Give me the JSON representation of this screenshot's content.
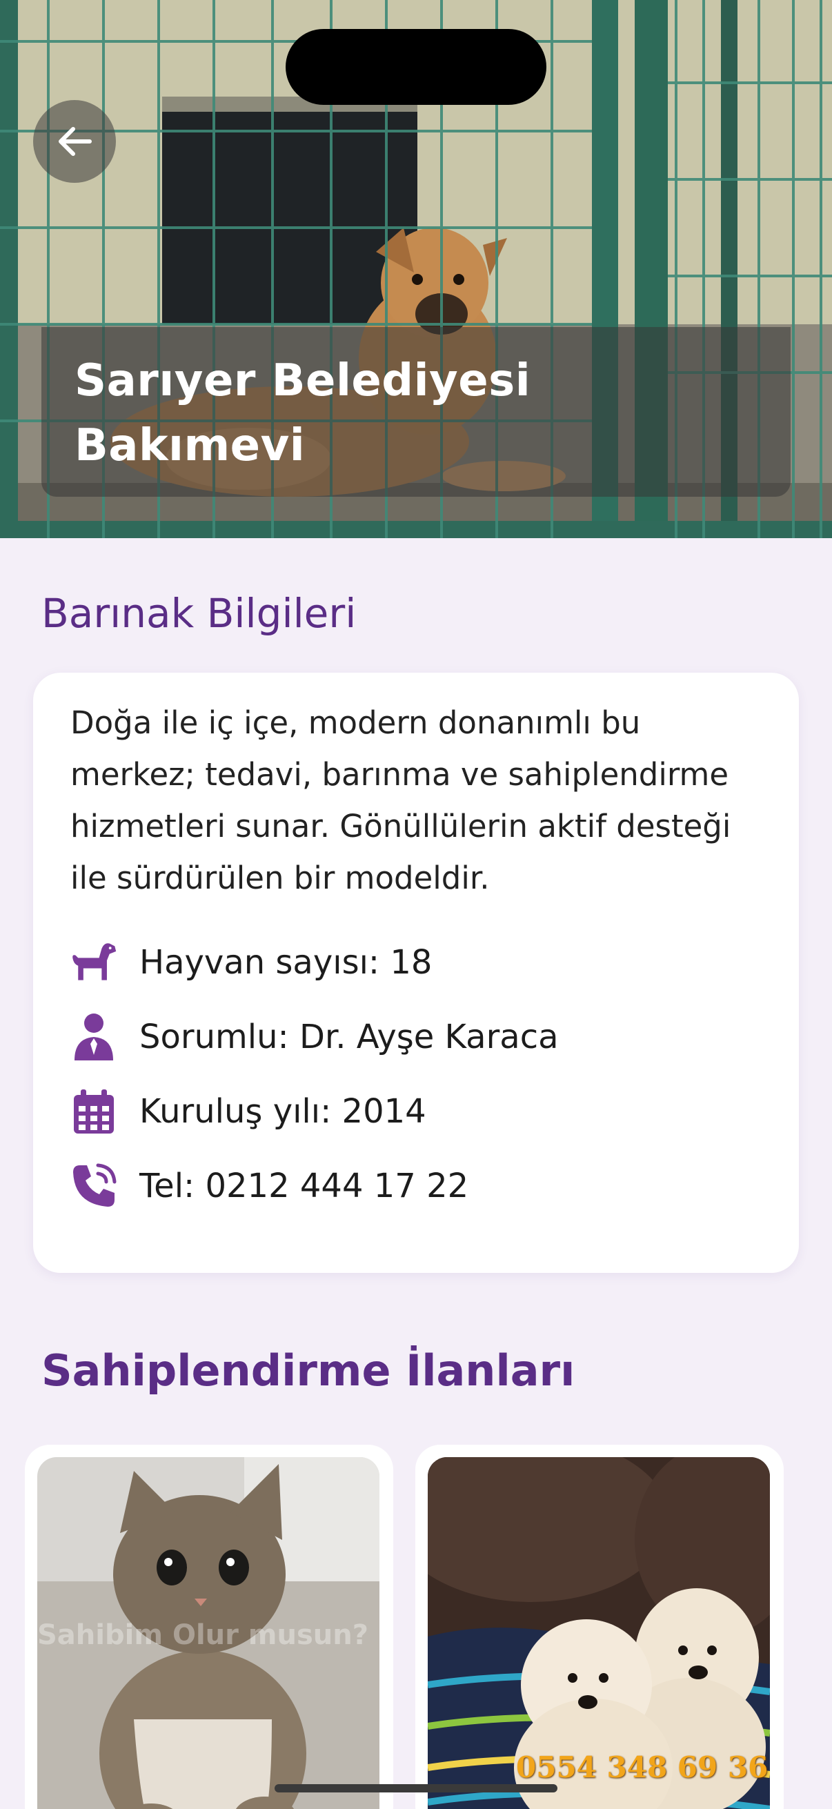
{
  "hero": {
    "title": "Sarıyer Belediyesi Bakımevi",
    "back_icon": "arrow-left-icon"
  },
  "info": {
    "section_title": "Barınak Bilgileri",
    "description": "Doğa ile iç içe, modern donanımlı bu merkez; tedavi, barınma ve sahiplendirme hizmetleri sunar. Gönüllülerin aktif desteği ile sürdürülen bir modeldir.",
    "rows": [
      {
        "icon": "dog-icon",
        "text": "Hayvan sayısı: 18"
      },
      {
        "icon": "person-icon",
        "text": "Sorumlu: Dr. Ayşe Karaca"
      },
      {
        "icon": "calendar-icon",
        "text": "Kuruluş yılı: 2014"
      },
      {
        "icon": "phone-icon",
        "text": "Tel: 0212 444 17 22"
      }
    ]
  },
  "listings": {
    "section_title": "Sahiplendirme İlanları",
    "items": [
      {
        "photo": "kitten-photo",
        "watermark": "Sahibim Olur musun?"
      },
      {
        "photo": "puppies-photo",
        "overlay_text": "0554 348 69 36"
      }
    ]
  },
  "colors": {
    "accent": "#5a2d86",
    "background": "#f4eff8",
    "icon": "#7a3b9a"
  }
}
